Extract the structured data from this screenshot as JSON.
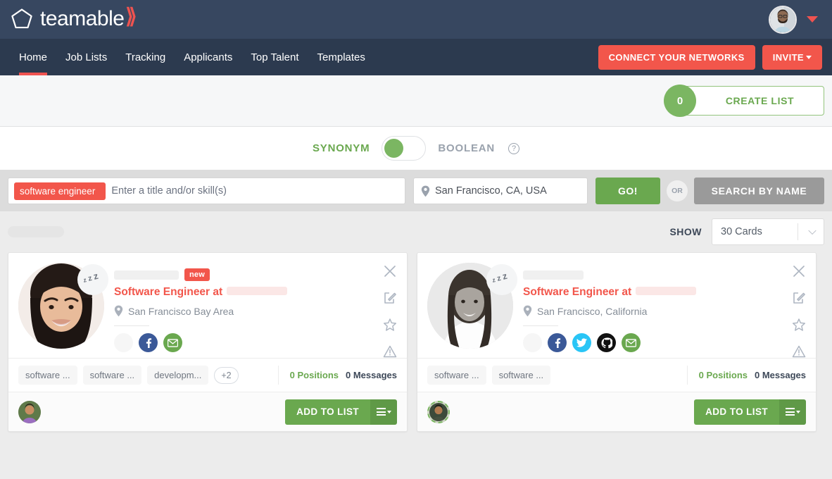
{
  "brand": {
    "name": "teamable",
    "logo_icon": "pentagon-outline-icon",
    "accent_red": "#f2564b",
    "accent_green": "#6aa84f",
    "header_bg": "#374760",
    "nav_bg": "#2c3a4f"
  },
  "header": {
    "avatar_icon": "user-avatar",
    "caret_icon": "chevron-down-icon"
  },
  "nav": {
    "items": [
      {
        "label": "Home",
        "active": true
      },
      {
        "label": "Job Lists",
        "active": false
      },
      {
        "label": "Tracking",
        "active": false
      },
      {
        "label": "Applicants",
        "active": false
      },
      {
        "label": "Top Talent",
        "active": false
      },
      {
        "label": "Templates",
        "active": false
      }
    ],
    "connect_label": "CONNECT YOUR NETWORKS",
    "invite_label": "INVITE"
  },
  "create_list": {
    "count": "0",
    "label": "CREATE LIST"
  },
  "mode": {
    "synonym_label": "SYNONYM",
    "boolean_label": "BOOLEAN",
    "help_icon": "question-mark-icon",
    "selected": "SYNONYM"
  },
  "search": {
    "chip_label": "software engineer",
    "chip_remove_icon": "x-icon",
    "skills_placeholder": "Enter a title and/or skill(s)",
    "location_value": "San Francisco, CA, USA",
    "location_icon": "map-pin-icon",
    "go_label": "GO!",
    "or_label": "OR",
    "search_by_name_label": "SEARCH BY NAME"
  },
  "show": {
    "label": "SHOW",
    "cards_value": "30 Cards",
    "chevron_icon": "chevron-down-icon"
  },
  "cards": [
    {
      "badge": "new",
      "job_title": "Software Engineer at",
      "location": "San Francisco Bay Area",
      "status_icon": "zzz-sleeping-icon",
      "status_text": "zZ",
      "socials": [
        "ghost",
        "facebook",
        "mail"
      ],
      "actions": [
        "close-icon",
        "edit-icon",
        "star-icon",
        "report-icon"
      ],
      "tags": [
        "software ...",
        "software ...",
        "developm..."
      ],
      "tags_more": "+2",
      "positions": "0 Positions",
      "messages": "0 Messages",
      "add_to_list_label": "ADD TO LIST",
      "menu_icon": "hamburger-menu-icon",
      "owner_avatar_dashed": false
    },
    {
      "badge": "",
      "job_title": "Software Engineer at",
      "location": "San Francisco, California",
      "status_icon": "zzz-sleeping-icon",
      "status_text": "zZ",
      "socials": [
        "ghost",
        "facebook",
        "twitter",
        "github",
        "mail"
      ],
      "actions": [
        "close-icon",
        "edit-icon",
        "star-icon",
        "report-icon"
      ],
      "tags": [
        "software ...",
        "software ..."
      ],
      "tags_more": "",
      "positions": "0 Positions",
      "messages": "0 Messages",
      "add_to_list_label": "ADD TO LIST",
      "menu_icon": "hamburger-menu-icon",
      "owner_avatar_dashed": true
    }
  ]
}
